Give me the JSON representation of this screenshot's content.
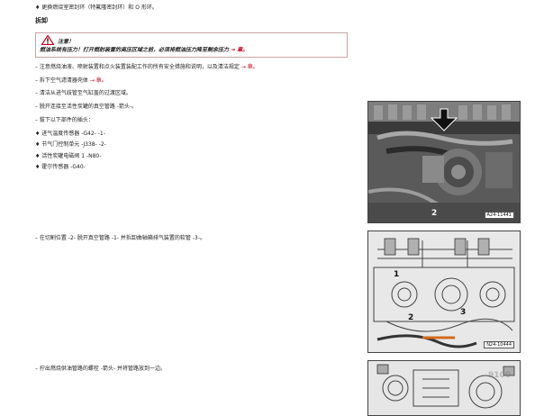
{
  "top_bullet": "♦ 更换燃烧室密封环（特氟隆密封环）和 O 形环。",
  "section_title": "拆卸",
  "warning": {
    "title": "注意！",
    "text_pre": "燃油系统有压力！打开燃射装置的高压区域之前，必须将燃油压力降至剩余压力 ",
    "link": "→ 章。"
  },
  "steps": [
    {
      "text": "– 注意燃烧油液、喷射装置和点火装置装配工作的所有安全措施和说明，以及清洁规定 ",
      "link": "→ 章。"
    },
    {
      "text": "– 拆下空气滤清器壳体 ",
      "link": "→ 章。"
    },
    {
      "text": "– 清洁从进气歧管至气缸盖的过渡区域。",
      "link": ""
    },
    {
      "text": "– 脱开连接至活性炭罐的真空管路 -箭头-。",
      "link": ""
    },
    {
      "text": "– 拔下以下部件的插头：",
      "link": ""
    }
  ],
  "connectors": [
    "♦ 进气温度传感器 -G42- -1-",
    "♦ 节气门控制单元 -J338- -2-",
    "♦ 活性炭罐电磁阀 1 -N80-",
    "♦ 霍尔传感器 -G40-"
  ],
  "step_cut": "– 在切割位置 -2- 脱开真空管路 -1- 并拆卸曲轴箱排气装置的软管 -3-。",
  "step_push": "– 拧出燃烧供油管路的螺栓 -箭头- 并将管路放到一边。",
  "figures": [
    {
      "id": "A24-11441",
      "labels": [
        "2"
      ]
    },
    {
      "id": "N24-10444",
      "labels": [
        "1",
        "2",
        "3"
      ]
    },
    {
      "id": "",
      "labels": []
    }
  ],
  "watermark": "9100"
}
